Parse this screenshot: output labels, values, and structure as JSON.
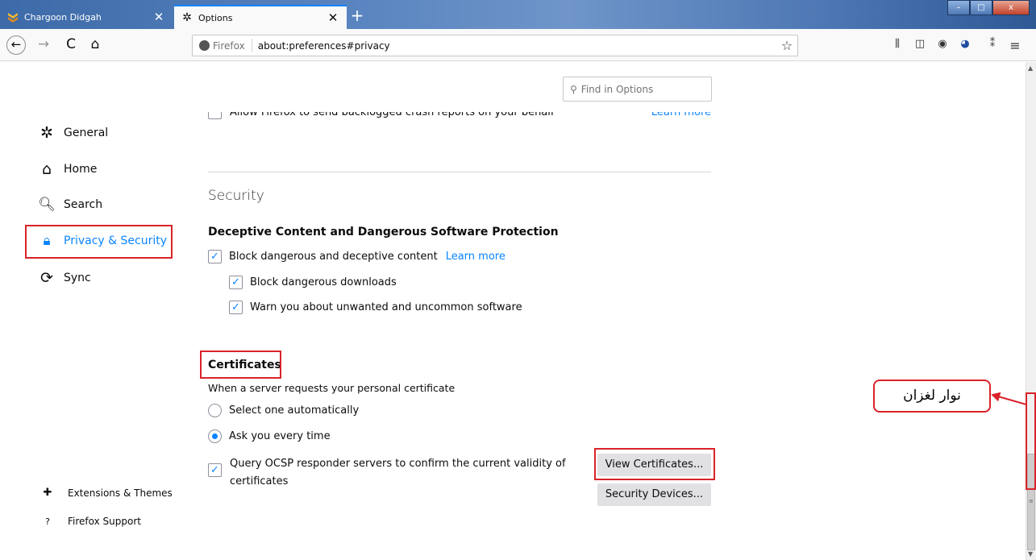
{
  "browser": {
    "tabs": [
      {
        "label": "Chargoon Didgah",
        "favicon": "chargoon-logo-icon",
        "close": "✕"
      },
      {
        "label": "Options",
        "favicon": "gear-icon",
        "close": "✕"
      }
    ],
    "new_tab": "+",
    "window_controls": {
      "minimize": "–",
      "maximize": "□",
      "close": "x"
    },
    "nav": {
      "back": "←",
      "forward": "→",
      "reload": "C",
      "home": "⌂"
    },
    "identity_label": "Firefox",
    "url": "about:preferences#privacy",
    "bookmark_star": "☆",
    "toolbar_icons": [
      "library-icon",
      "sidebar-icon",
      "account-icon",
      "extension-icon",
      "addon-icon",
      "menu-icon"
    ],
    "toolbar_glyphs": [
      "⫼",
      "◫",
      "◉",
      "◕",
      "⁑",
      "≡"
    ]
  },
  "search": {
    "placeholder": "Find in Options",
    "icon": "⚲"
  },
  "sidebar": {
    "items": [
      {
        "label": "General",
        "icon": "✲"
      },
      {
        "label": "Home",
        "icon": "⌂"
      },
      {
        "label": "Search",
        "icon": "🔍︎"
      },
      {
        "label": "Privacy & Security",
        "icon": "🔒︎"
      },
      {
        "label": "Sync",
        "icon": "⟳"
      }
    ],
    "footer": [
      {
        "label": "Extensions & Themes",
        "icon": "✚"
      },
      {
        "label": "Firefox Support",
        "icon": "?"
      }
    ],
    "selected": "Privacy & Security"
  },
  "main": {
    "crash_reports": {
      "label": "Allow Firefox to send backlogged crash reports on your behalf",
      "link": "Learn more",
      "checked": false
    },
    "section_title": "Security",
    "deceptive": {
      "heading": "Deceptive Content and Dangerous Software Protection",
      "block_content": {
        "label": "Block dangerous and deceptive content",
        "link": "Learn more",
        "checked": true
      },
      "block_downloads": {
        "label": "Block dangerous downloads",
        "checked": true
      },
      "warn_unwanted": {
        "label": "Warn you about unwanted and uncommon software",
        "checked": true
      }
    },
    "certificates": {
      "heading": "Certificates",
      "question": "When a server requests your personal certificate",
      "options": [
        {
          "label": "Select one automatically",
          "selected": false
        },
        {
          "label": "Ask you every time",
          "selected": true
        }
      ],
      "ocsp": {
        "label": "Query OCSP responder servers to confirm the current validity of certificates",
        "checked": true
      },
      "view_button": "View Certificates...",
      "devices_button": "Security Devices..."
    }
  },
  "annotation": {
    "callout_text": "نوار لغزان",
    "color": "#d9232a"
  },
  "colors": {
    "accent": "#0a84ff",
    "highlight": "#d9232a"
  }
}
